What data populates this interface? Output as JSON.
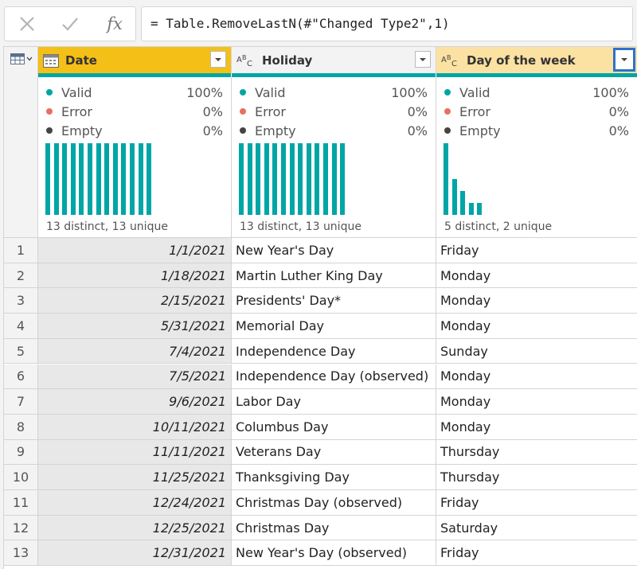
{
  "formula_bar": {
    "formula": "= Table.RemoveLastN(#\"Changed Type2\",1)",
    "fx_label": "fx",
    "cancel_icon": "close-icon",
    "commit_icon": "checkmark-icon"
  },
  "columns": [
    {
      "name": "Date",
      "type_icon": "calendar-icon",
      "quality": {
        "valid": "100%",
        "error": "0%",
        "empty": "0%"
      },
      "distinct_text": "13 distinct, 13 unique",
      "histogram": [
        1,
        1,
        1,
        1,
        1,
        1,
        1,
        1,
        1,
        1,
        1,
        1,
        1
      ]
    },
    {
      "name": "Holiday",
      "type_icon": "text-type-icon",
      "type_label": "ABC",
      "quality": {
        "valid": "100%",
        "error": "0%",
        "empty": "0%"
      },
      "distinct_text": "13 distinct, 13 unique",
      "histogram": [
        1,
        1,
        1,
        1,
        1,
        1,
        1,
        1,
        1,
        1,
        1,
        1,
        1
      ]
    },
    {
      "name": "Day of the week",
      "type_icon": "text-type-icon",
      "type_label": "ABC",
      "quality": {
        "valid": "100%",
        "error": "0%",
        "empty": "0%"
      },
      "distinct_text": "5 distinct, 2 unique",
      "histogram": [
        6,
        3,
        2,
        1,
        1
      ]
    }
  ],
  "quality_labels": {
    "valid": "Valid",
    "error": "Error",
    "empty": "Empty"
  },
  "colors": {
    "accent_teal": "#00a5a5",
    "error_red": "#e8705f",
    "empty_gray": "#444444",
    "selected_header": "#f4c017",
    "hover_header": "#fbe2a2",
    "focus_blue": "#2f72c8"
  },
  "rows": [
    {
      "n": "1",
      "date": "1/1/2021",
      "holiday": "New Year's Day",
      "dow": "Friday"
    },
    {
      "n": "2",
      "date": "1/18/2021",
      "holiday": "Martin Luther King Day",
      "dow": "Monday"
    },
    {
      "n": "3",
      "date": "2/15/2021",
      "holiday": "Presidents' Day*",
      "dow": "Monday"
    },
    {
      "n": "4",
      "date": "5/31/2021",
      "holiday": "Memorial Day",
      "dow": "Monday"
    },
    {
      "n": "5",
      "date": "7/4/2021",
      "holiday": "Independence Day",
      "dow": "Sunday"
    },
    {
      "n": "6",
      "date": "7/5/2021",
      "holiday": "Independence Day (observed)",
      "dow": "Monday"
    },
    {
      "n": "7",
      "date": "9/6/2021",
      "holiday": "Labor Day",
      "dow": "Monday"
    },
    {
      "n": "8",
      "date": "10/11/2021",
      "holiday": "Columbus Day",
      "dow": "Monday"
    },
    {
      "n": "9",
      "date": "11/11/2021",
      "holiday": "Veterans Day",
      "dow": "Thursday"
    },
    {
      "n": "10",
      "date": "11/25/2021",
      "holiday": "Thanksgiving Day",
      "dow": "Thursday"
    },
    {
      "n": "11",
      "date": "12/24/2021",
      "holiday": "Christmas Day (observed)",
      "dow": "Friday"
    },
    {
      "n": "12",
      "date": "12/25/2021",
      "holiday": "Christmas Day",
      "dow": "Saturday"
    },
    {
      "n": "13",
      "date": "12/31/2021",
      "holiday": "New Year's Day (observed)",
      "dow": "Friday"
    }
  ]
}
